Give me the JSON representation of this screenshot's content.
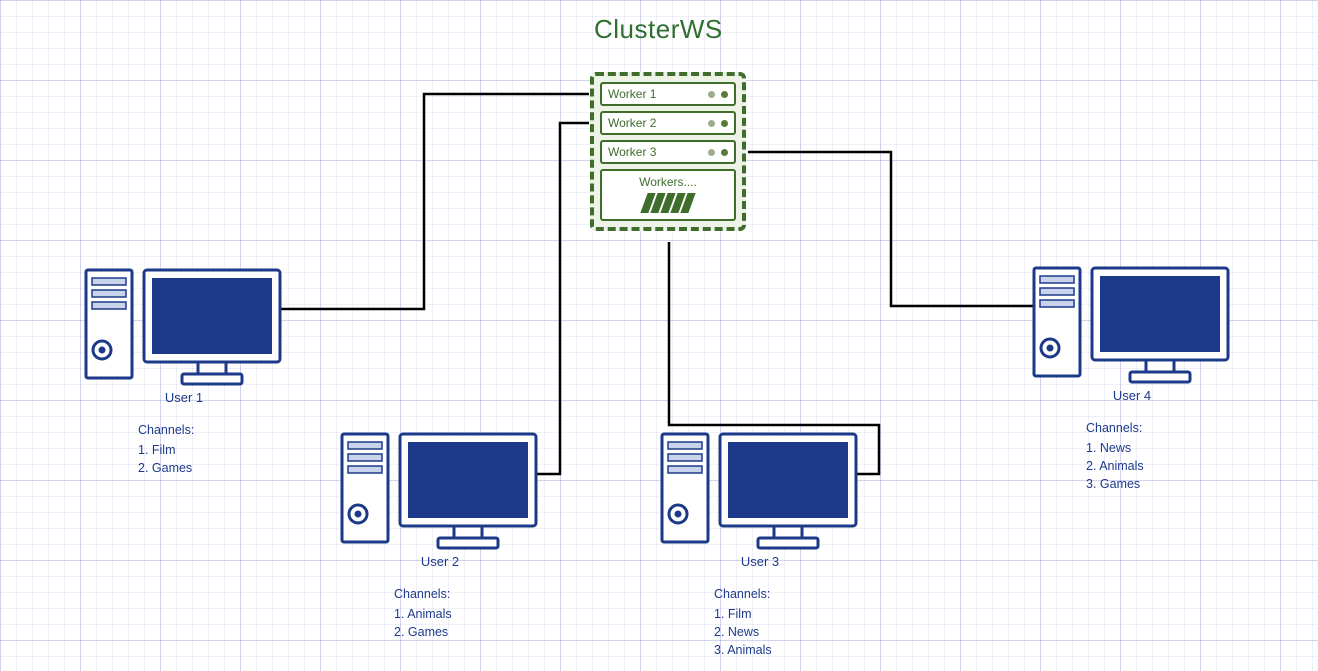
{
  "title": "ClusterWS",
  "server": {
    "workers": [
      "Worker 1",
      "Worker 2",
      "Worker 3"
    ],
    "more_label": "Workers...."
  },
  "channels_header": "Channels:",
  "users": {
    "u1": {
      "name": "User 1",
      "channels": [
        "1. Film",
        "2. Games"
      ]
    },
    "u2": {
      "name": "User 2",
      "channels": [
        "1. Animals",
        "2. Games"
      ]
    },
    "u3": {
      "name": "User 3",
      "channels": [
        "1. Film",
        "2. News",
        "3. Animals"
      ]
    },
    "u4": {
      "name": "User 4",
      "channels": [
        "1. News",
        "2. Animals",
        "3. Games"
      ]
    }
  }
}
